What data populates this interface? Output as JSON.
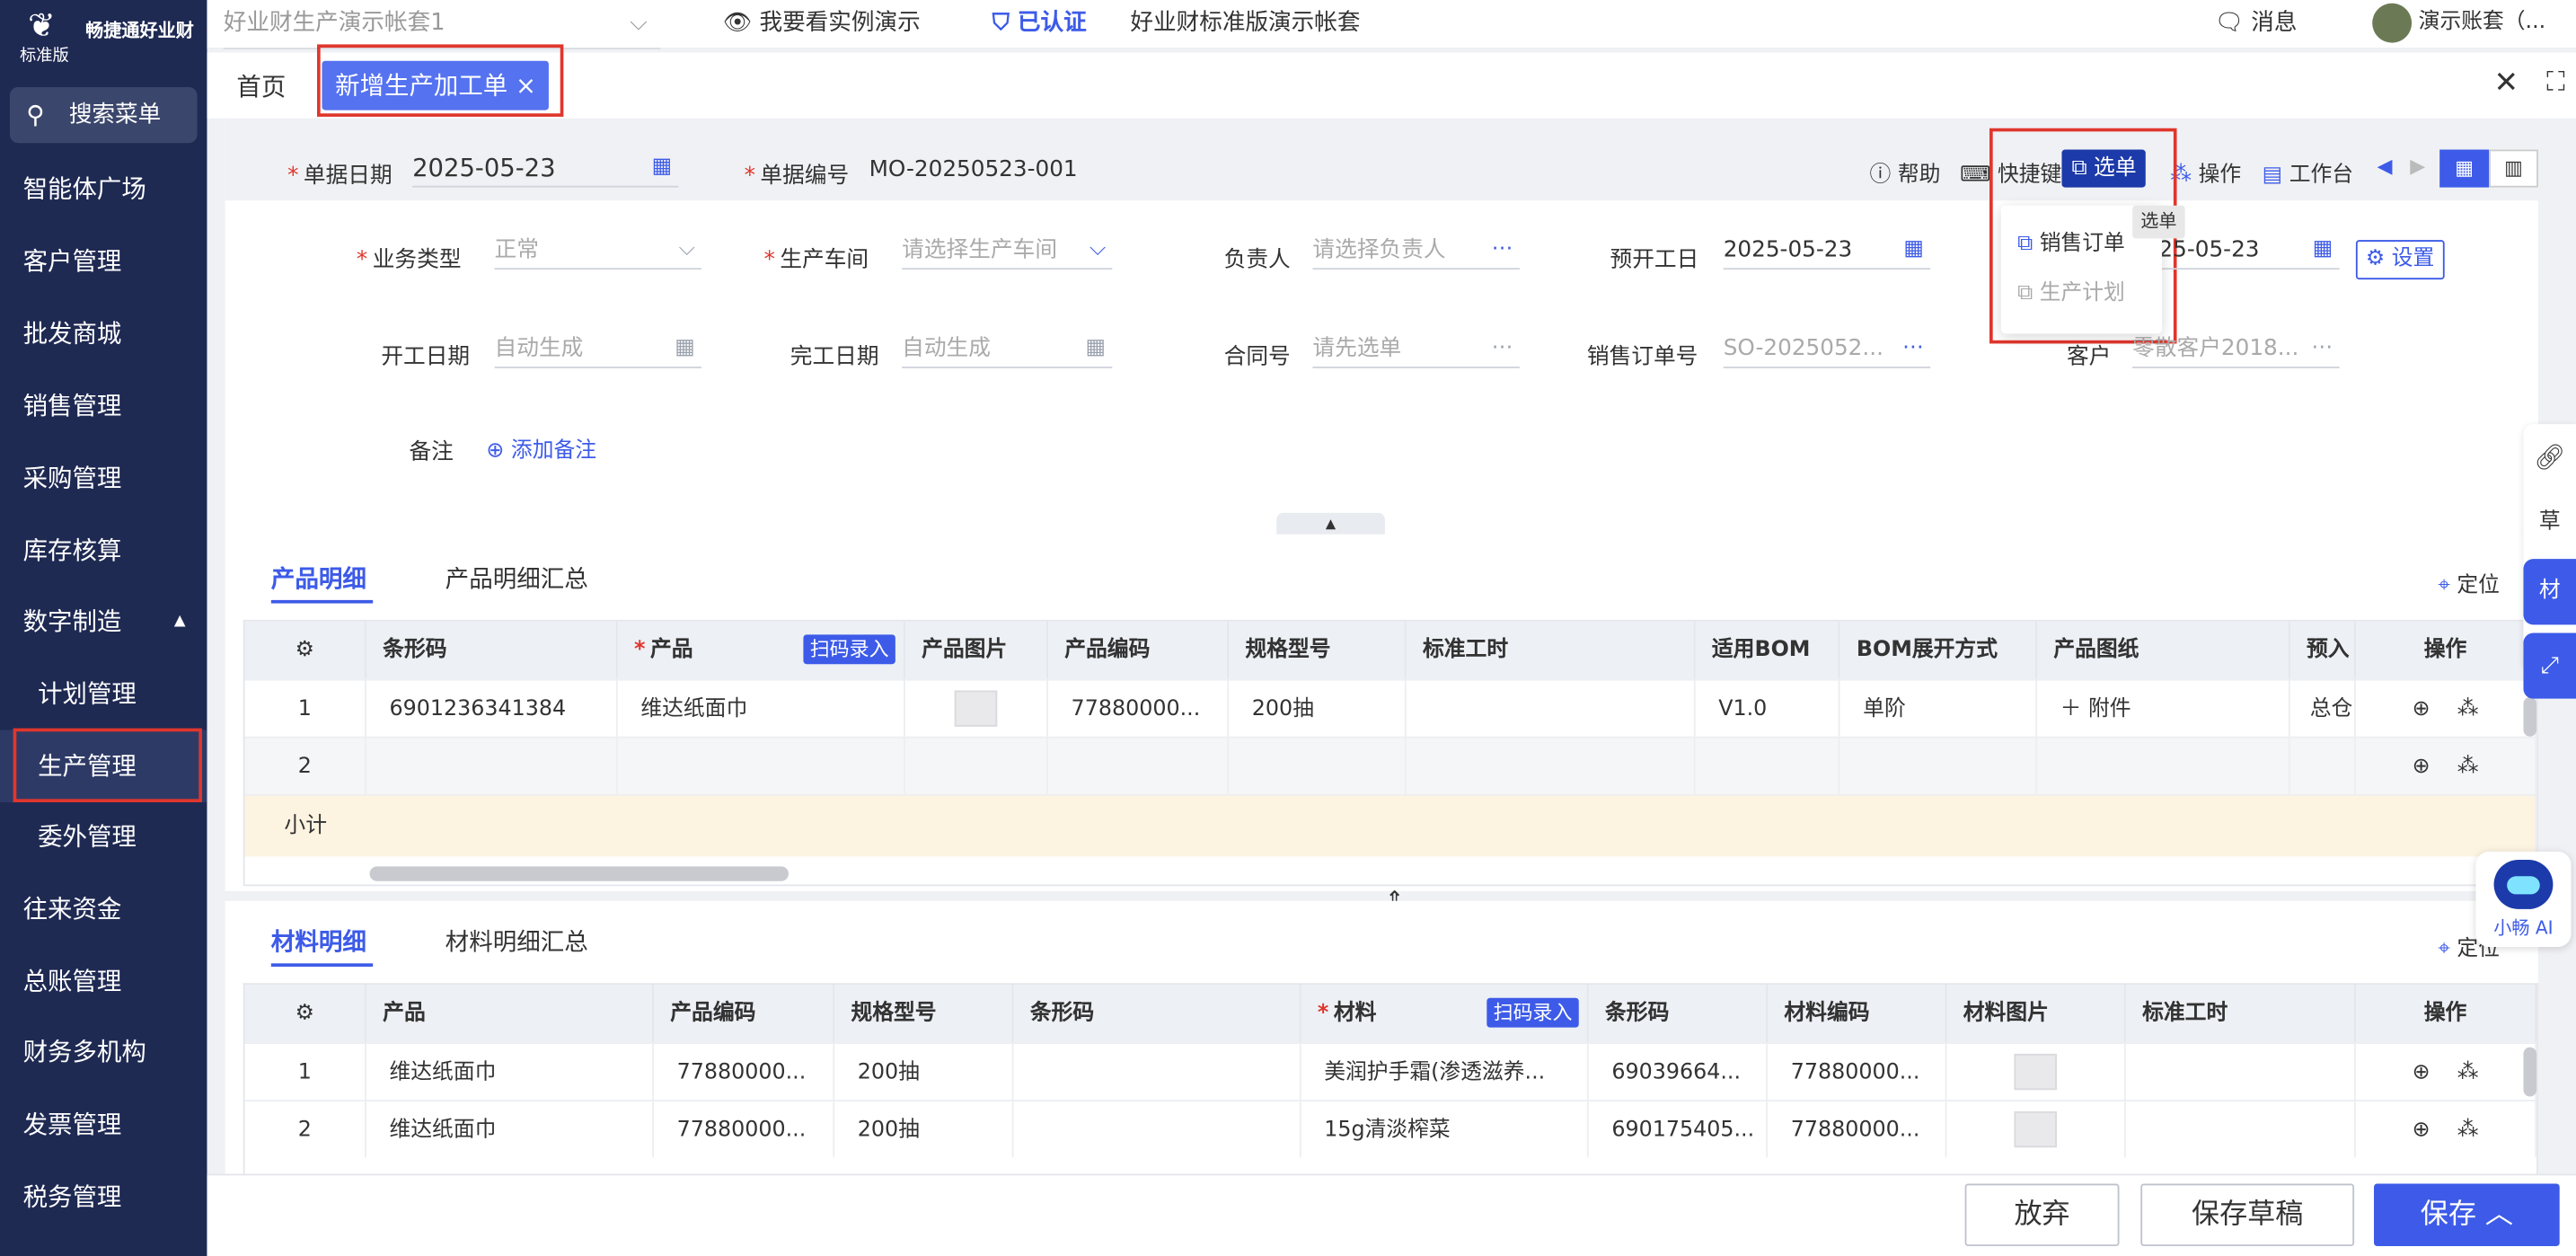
{
  "sidebar": {
    "brand": "畅捷通好业财",
    "edition": "标准版",
    "search_label": "搜索菜单",
    "items": [
      {
        "label": "智能体广场",
        "key": "agent"
      },
      {
        "label": "客户管理",
        "key": "crm"
      },
      {
        "label": "批发商城",
        "key": "mall"
      },
      {
        "label": "销售管理",
        "key": "sales"
      },
      {
        "label": "采购管理",
        "key": "purchase"
      },
      {
        "label": "库存核算",
        "key": "inventory"
      },
      {
        "label": "数字制造",
        "key": "mfg"
      },
      {
        "label": "计划管理",
        "key": "plan"
      },
      {
        "label": "生产管理",
        "key": "production"
      },
      {
        "label": "委外管理",
        "key": "outsource"
      },
      {
        "label": "往来资金",
        "key": "funds"
      },
      {
        "label": "总账管理",
        "key": "ledger"
      },
      {
        "label": "财务多机构",
        "key": "multi"
      },
      {
        "label": "发票管理",
        "key": "invoice"
      },
      {
        "label": "税务管理",
        "key": "tax"
      }
    ]
  },
  "topbar": {
    "account_select": "好业财生产演示帐套1",
    "demo_link": "我要看实例演示",
    "verified": "已认证",
    "company": "好业财标准版演示帐套",
    "messages": "消息",
    "user": "演示账套（..."
  },
  "tabs": {
    "home": "首页",
    "current": "新增生产加工单"
  },
  "form": {
    "date_label": "单据日期",
    "date_value": "2025-05-23",
    "no_label": "单据编号",
    "no_value": "MO-20250523-001",
    "toolbar": {
      "help": "帮助",
      "shortcut": "快捷键",
      "select": "选单",
      "ops": "操作",
      "workbench": "工作台",
      "settings": "设置"
    },
    "biz_type_label": "业务类型",
    "biz_type_value": "正常",
    "workshop_label": "生产车间",
    "workshop_placeholder": "请选择生产车间",
    "owner_label": "负责人",
    "owner_placeholder": "请选择负责人",
    "plan_start_label": "预开工日",
    "plan_start_value": "2025-05-23",
    "plan_end_value": "25-05-23",
    "start_label": "开工日期",
    "start_placeholder": "自动生成",
    "finish_label": "完工日期",
    "finish_placeholder": "自动生成",
    "contract_label": "合同号",
    "contract_placeholder": "请先选单",
    "so_label": "销售订单号",
    "so_value": "SO-2025052...",
    "customer_label": "客户",
    "customer_value": "零散客户2018...",
    "remark_label": "备注",
    "add_remark": "添加备注"
  },
  "dropdown": {
    "items": [
      "销售订单",
      "生产计划"
    ],
    "tooltip": "选单"
  },
  "product_section": {
    "tabs": [
      "产品明细",
      "产品明细汇总"
    ],
    "locate": "定位",
    "scan": "扫码录入",
    "headers": [
      "条形码",
      "产品",
      "产品图片",
      "产品编码",
      "规格型号",
      "标准工时",
      "适用BOM",
      "BOM展开方式",
      "产品图纸",
      "预入",
      "操作"
    ],
    "rows": [
      {
        "no": "1",
        "barcode": "6901236341384",
        "product": "维达纸面巾",
        "code": "77880000...",
        "spec": "200抽",
        "bom": "V1.0",
        "bom_mode": "单阶",
        "drawing": "＋ 附件",
        "pre": "总仓"
      },
      {
        "no": "2",
        "barcode": "",
        "product": "",
        "code": "",
        "spec": "",
        "bom": "",
        "bom_mode": "",
        "drawing": "",
        "pre": ""
      }
    ],
    "subtotal": "小计"
  },
  "material_section": {
    "tabs": [
      "材料明细",
      "材料明细汇总"
    ],
    "locate": "定位",
    "scan": "扫码录入",
    "headers": [
      "产品",
      "产品编码",
      "规格型号",
      "条形码",
      "材料",
      "条形码",
      "材料编码",
      "材料图片",
      "标准工时",
      "操作"
    ],
    "rows": [
      {
        "no": "1",
        "product": "维达纸面巾",
        "code": "77880000...",
        "spec": "200抽",
        "barcode": "",
        "material": "美润护手霜(渗透滋养...",
        "mbarcode": "69039664...",
        "mcode": "77880000..."
      },
      {
        "no": "2",
        "product": "维达纸面巾",
        "code": "77880000...",
        "spec": "200抽",
        "barcode": "",
        "material": "15g清淡榨菜",
        "mbarcode": "690175405...",
        "mcode": "77880000..."
      }
    ]
  },
  "footer": {
    "discard": "放弃",
    "draft": "保存草稿",
    "save": "保存"
  },
  "side_tools": {
    "draft_char": "草",
    "mat_char": "材",
    "ai": "小畅 AI"
  },
  "colors": {
    "accent": "#3d5be8",
    "sidebar": "#1f2a53",
    "highlight": "#e0362c",
    "subtotal": "#fdf3e1"
  }
}
